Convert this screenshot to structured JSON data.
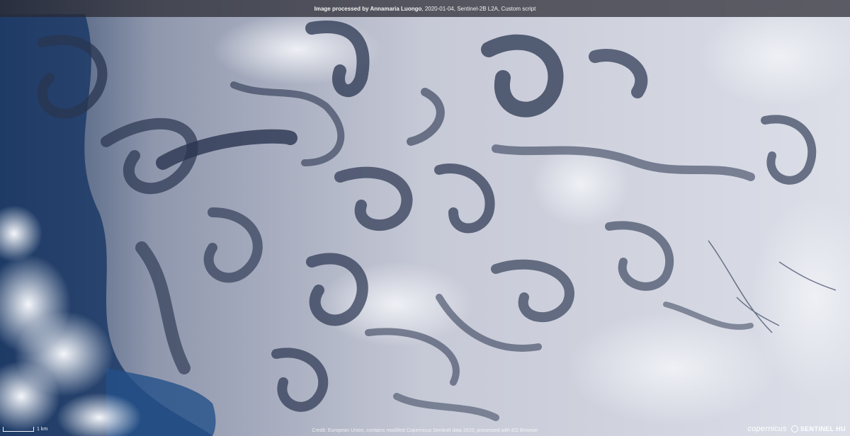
{
  "caption": {
    "lead": "Image processed by Annamaria Luongo",
    "details": ", 2020-01-04, Sentinel-2B L2A, Custom script"
  },
  "scale_bar": {
    "label": "1 km"
  },
  "credit": "Credit: European Union, contains modified Copernicus Sentinel data 2020, processed with EO Browser",
  "logos": {
    "copernicus": "opernicus",
    "sentinel_hub": "SENTINEL HU"
  },
  "colors": {
    "ice_light": "#dfe1ea",
    "ice_mid": "#aeb2c2",
    "water_dark": "#2a3550",
    "water_deep": "#1c3a66",
    "caption_bg": "#282830"
  }
}
